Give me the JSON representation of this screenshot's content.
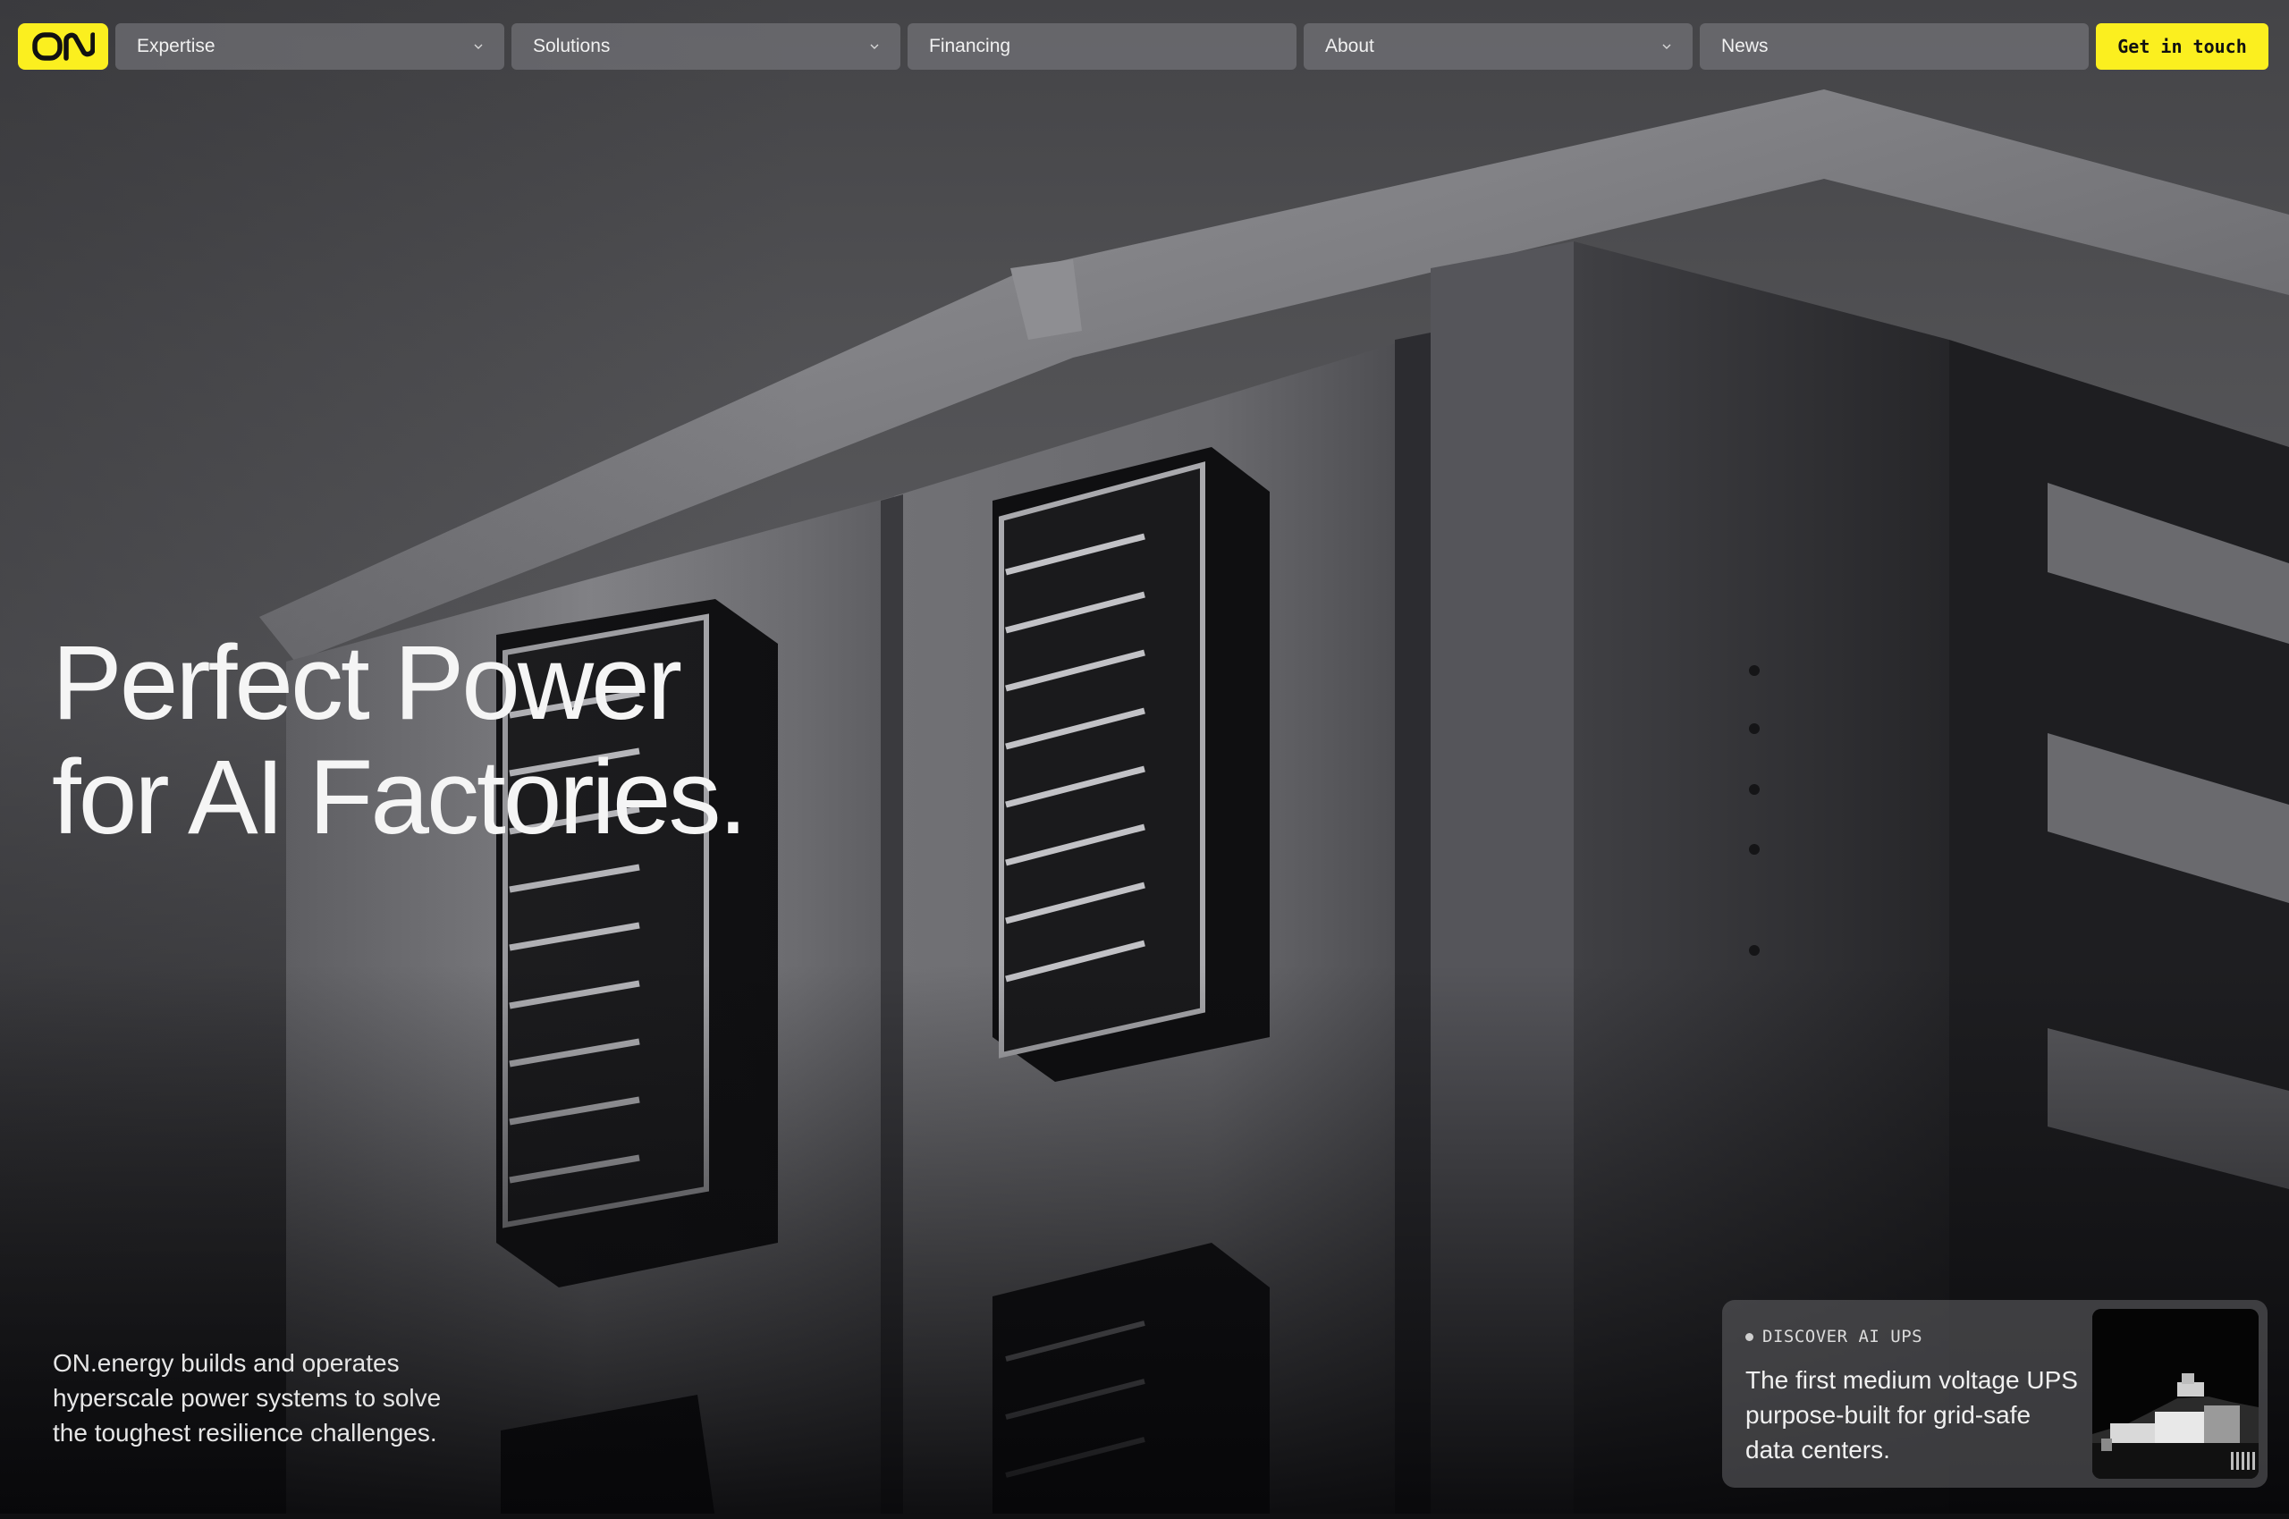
{
  "brand": {
    "logo_text": "ON",
    "accent_color": "#fbef1f"
  },
  "nav": {
    "items": [
      {
        "label": "Expertise",
        "has_dropdown": true
      },
      {
        "label": "Solutions",
        "has_dropdown": true
      },
      {
        "label": "Financing",
        "has_dropdown": false
      },
      {
        "label": "About",
        "has_dropdown": true
      },
      {
        "label": "News",
        "has_dropdown": false
      }
    ],
    "cta_label": "Get in touch"
  },
  "hero": {
    "headline_line1": "Perfect Power",
    "headline_line2": "for AI Factories.",
    "intro": "ON.energy builds and operates hyperscale power systems to solve the toughest resilience challenges."
  },
  "promo": {
    "tag": "DISCOVER AI UPS",
    "description": "The first medium voltage UPS purpose-built for grid-safe data centers."
  },
  "icons": {
    "chevron": "chevron-down-icon",
    "dot": "bullet-dot-icon"
  }
}
